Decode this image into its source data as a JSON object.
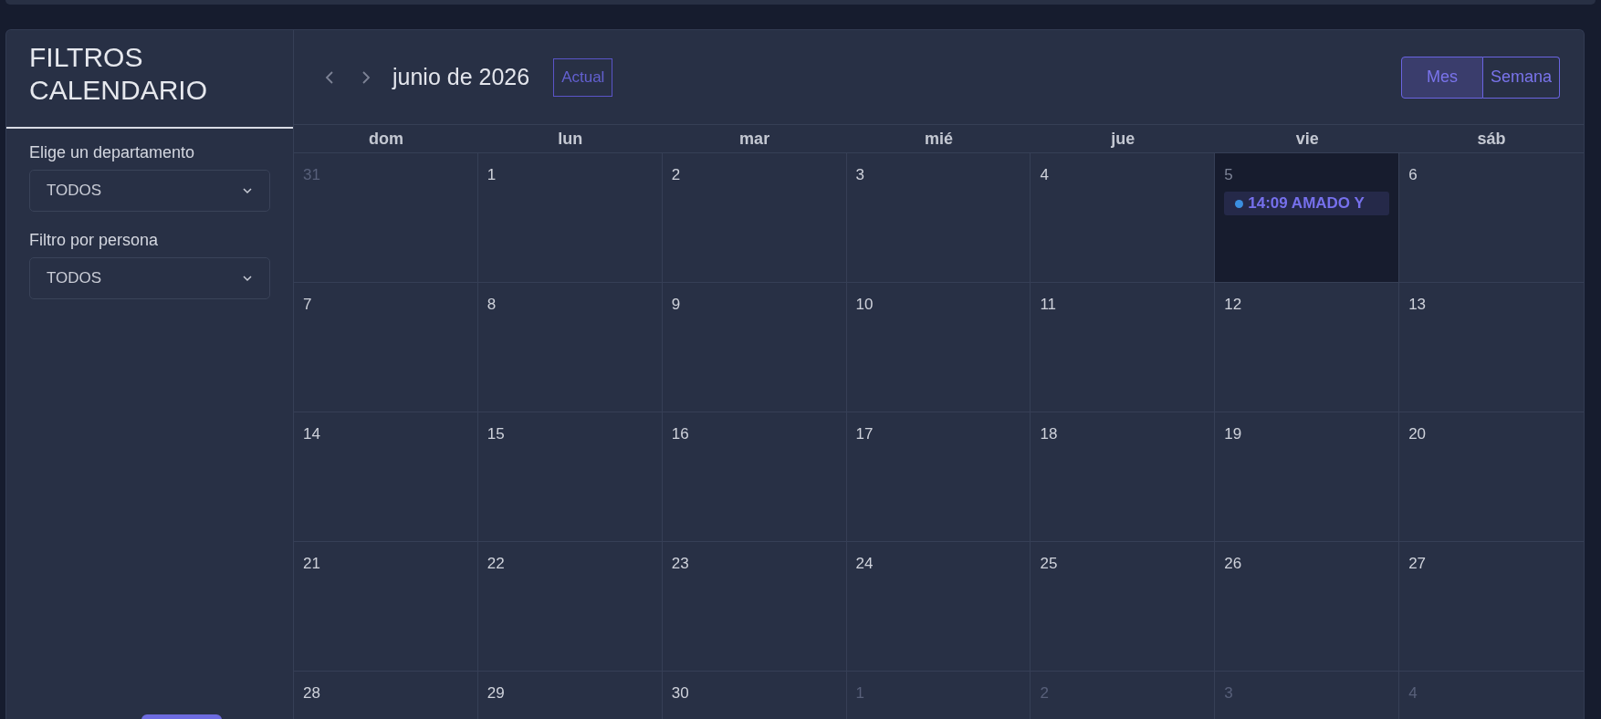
{
  "sidebar": {
    "title": "FILTROS CALENDARIO",
    "filters": [
      {
        "label": "Elige un departamento",
        "value": "TODOS"
      },
      {
        "label": "Filtro por persona",
        "value": "TODOS"
      }
    ]
  },
  "calendar": {
    "title": "junio de 2026",
    "today_button": "Actual",
    "views": [
      {
        "label": "Mes",
        "selected": true
      },
      {
        "label": "Semana",
        "selected": false
      }
    ],
    "weekdays": [
      "dom",
      "lun",
      "mar",
      "mié",
      "jue",
      "vie",
      "sáb"
    ],
    "weeks": [
      [
        {
          "day": "31",
          "other_month": true,
          "today": false
        },
        {
          "day": "1",
          "other_month": false,
          "today": false
        },
        {
          "day": "2",
          "other_month": false,
          "today": false
        },
        {
          "day": "3",
          "other_month": false,
          "today": false
        },
        {
          "day": "4",
          "other_month": false,
          "today": false
        },
        {
          "day": "5",
          "other_month": false,
          "today": true,
          "events": [
            {
              "text": "14:09 AMADO Y",
              "color": "#3b8fe0"
            }
          ]
        },
        {
          "day": "6",
          "other_month": false,
          "today": false
        }
      ],
      [
        {
          "day": "7",
          "other_month": false,
          "today": false
        },
        {
          "day": "8",
          "other_month": false,
          "today": false
        },
        {
          "day": "9",
          "other_month": false,
          "today": false
        },
        {
          "day": "10",
          "other_month": false,
          "today": false
        },
        {
          "day": "11",
          "other_month": false,
          "today": false
        },
        {
          "day": "12",
          "other_month": false,
          "today": false
        },
        {
          "day": "13",
          "other_month": false,
          "today": false
        }
      ],
      [
        {
          "day": "14",
          "other_month": false,
          "today": false
        },
        {
          "day": "15",
          "other_month": false,
          "today": false
        },
        {
          "day": "16",
          "other_month": false,
          "today": false
        },
        {
          "day": "17",
          "other_month": false,
          "today": false
        },
        {
          "day": "18",
          "other_month": false,
          "today": false
        },
        {
          "day": "19",
          "other_month": false,
          "today": false
        },
        {
          "day": "20",
          "other_month": false,
          "today": false
        }
      ],
      [
        {
          "day": "21",
          "other_month": false,
          "today": false
        },
        {
          "day": "22",
          "other_month": false,
          "today": false
        },
        {
          "day": "23",
          "other_month": false,
          "today": false
        },
        {
          "day": "24",
          "other_month": false,
          "today": false
        },
        {
          "day": "25",
          "other_month": false,
          "today": false
        },
        {
          "day": "26",
          "other_month": false,
          "today": false
        },
        {
          "day": "27",
          "other_month": false,
          "today": false
        }
      ],
      [
        {
          "day": "28",
          "other_month": false,
          "today": false
        },
        {
          "day": "29",
          "other_month": false,
          "today": false
        },
        {
          "day": "30",
          "other_month": false,
          "today": false
        },
        {
          "day": "1",
          "other_month": true,
          "today": false
        },
        {
          "day": "2",
          "other_month": true,
          "today": false
        },
        {
          "day": "3",
          "other_month": true,
          "today": false
        },
        {
          "day": "4",
          "other_month": true,
          "today": false
        }
      ]
    ]
  }
}
